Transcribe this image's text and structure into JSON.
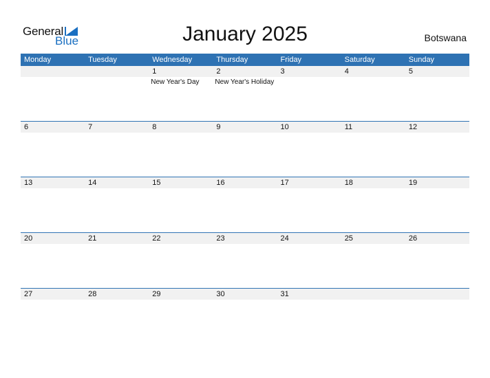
{
  "logo": {
    "general": "General",
    "blue": "Blue"
  },
  "title": "January 2025",
  "country": "Botswana",
  "colors": {
    "accent": "#2e72b3",
    "logo_blue": "#1a6fc1",
    "strip": "#f1f1f1"
  },
  "weekdays": [
    "Monday",
    "Tuesday",
    "Wednesday",
    "Thursday",
    "Friday",
    "Saturday",
    "Sunday"
  ],
  "weeks": [
    [
      {
        "day": ""
      },
      {
        "day": ""
      },
      {
        "day": "1",
        "holiday": "New Year's Day"
      },
      {
        "day": "2",
        "holiday": "New Year's Holiday"
      },
      {
        "day": "3"
      },
      {
        "day": "4"
      },
      {
        "day": "5"
      }
    ],
    [
      {
        "day": "6"
      },
      {
        "day": "7"
      },
      {
        "day": "8"
      },
      {
        "day": "9"
      },
      {
        "day": "10"
      },
      {
        "day": "11"
      },
      {
        "day": "12"
      }
    ],
    [
      {
        "day": "13"
      },
      {
        "day": "14"
      },
      {
        "day": "15"
      },
      {
        "day": "16"
      },
      {
        "day": "17"
      },
      {
        "day": "18"
      },
      {
        "day": "19"
      }
    ],
    [
      {
        "day": "20"
      },
      {
        "day": "21"
      },
      {
        "day": "22"
      },
      {
        "day": "23"
      },
      {
        "day": "24"
      },
      {
        "day": "25"
      },
      {
        "day": "26"
      }
    ],
    [
      {
        "day": "27"
      },
      {
        "day": "28"
      },
      {
        "day": "29"
      },
      {
        "day": "30"
      },
      {
        "day": "31"
      },
      {
        "day": ""
      },
      {
        "day": ""
      }
    ]
  ]
}
